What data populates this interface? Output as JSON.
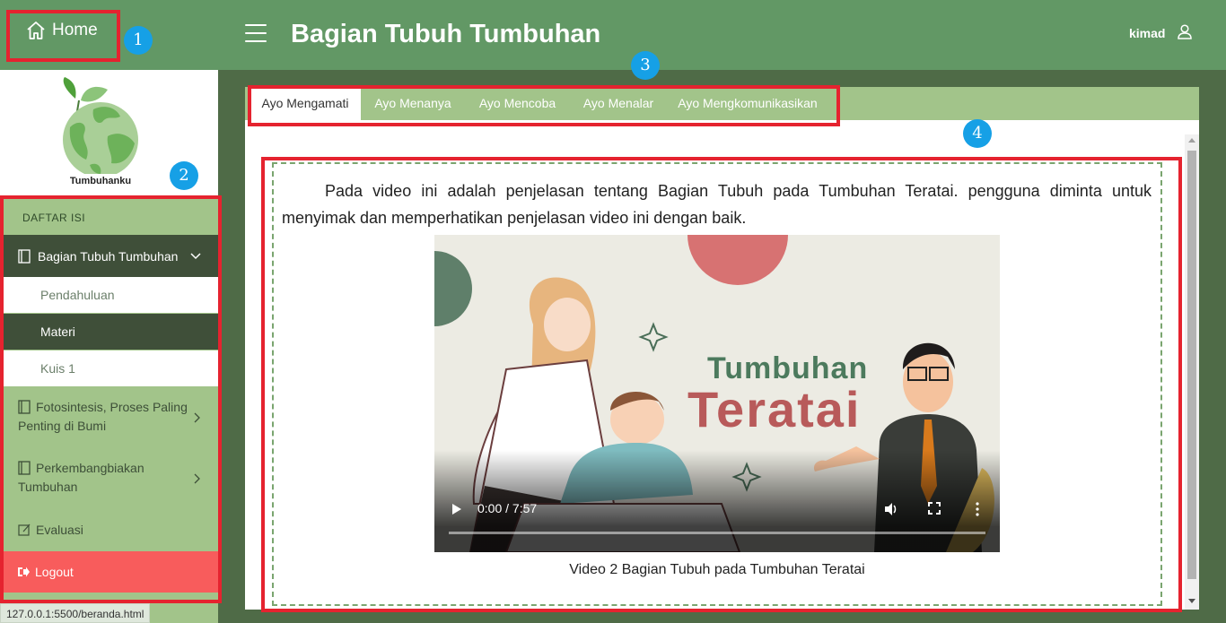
{
  "header": {
    "home_label": "Home",
    "title": "Bagian Tubuh Tumbuhan",
    "username": "kimad"
  },
  "sidebar": {
    "logo_text": "Tumbuhanku",
    "toc_label": "DAFTAR ISI",
    "active_section": "Bagian Tubuh Tumbuhan",
    "sub_items": [
      "Pendahuluan",
      "Materi",
      "Kuis 1"
    ],
    "other_sections": [
      "Fotosintesis, Proses Paling Penting di Bumi",
      "Perkembangbiakan Tumbuhan"
    ],
    "evaluasi": "Evaluasi",
    "logout": "Logout"
  },
  "status_url": "127.0.0.1:5500/beranda.html",
  "tabs": [
    "Ayo Mengamati",
    "Ayo Menanya",
    "Ayo Mencoba",
    "Ayo Menalar",
    "Ayo Mengkomunikasikan"
  ],
  "content": {
    "paragraph": "Pada video ini adalah penjelasan tentang Bagian Tubuh pada Tumbuhan Teratai. pengguna diminta untuk menyimak dan memperhatikan penjelasan video ini dengan baik.",
    "video_title_top": "Tumbuhan",
    "video_title_bottom": "Teratai",
    "video_time": "0:00 / 7:57",
    "video_progress": 0,
    "caption": "Video 2 Bagian Tubuh pada Tumbuhan Teratai"
  },
  "annotations": [
    "1",
    "2",
    "3",
    "4"
  ],
  "colors": {
    "header": "#629865",
    "sidebar": "#a2c48a",
    "nav_active": "#3f4f39",
    "logout": "#f85c5c",
    "annotation_box": "#e5232f",
    "annotation_badge": "#16a0e6"
  },
  "icons": [
    "home-icon",
    "hamburger-icon",
    "user-icon",
    "book-icon",
    "chevron-down-icon",
    "chevron-right-icon",
    "edit-icon",
    "logout-icon",
    "play-icon",
    "volume-icon",
    "fullscreen-icon",
    "more-icon"
  ]
}
